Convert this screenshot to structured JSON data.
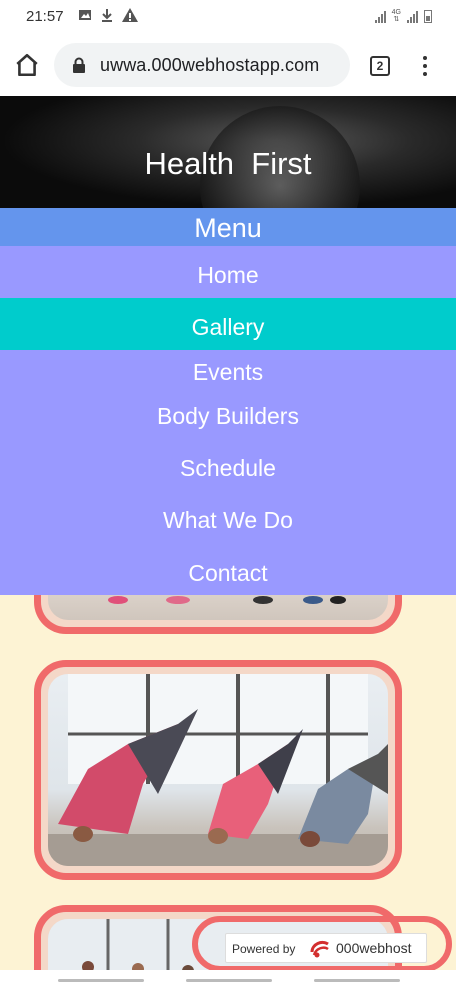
{
  "status_bar": {
    "time": "21:57",
    "left_icons": [
      "image-icon",
      "download-icon",
      "warning-icon"
    ],
    "right_icons": [
      "signal-icon",
      "4g-icon",
      "signal-icon",
      "battery-icon"
    ],
    "network_label": "4G"
  },
  "browser": {
    "url": "uwwa.000webhostapp.com",
    "tab_count": "2"
  },
  "hero": {
    "title": "Health  First"
  },
  "menu": {
    "header": "Menu",
    "items": [
      {
        "label": "Home"
      },
      {
        "label": "Gallery",
        "active": true
      },
      {
        "label": "Events"
      },
      {
        "label": "Body Builders"
      },
      {
        "label": "Schedule"
      },
      {
        "label": "What We Do"
      },
      {
        "label": "Contact"
      }
    ]
  },
  "gallery": {
    "images": [
      "fitness-class-feet-image",
      "yoga-downward-dog-class-image",
      "fitness-class-image"
    ]
  },
  "footer_badge": {
    "label": "Powered by",
    "brand": "000webhost"
  },
  "colors": {
    "menu_header": "#6495ed",
    "menu_bg": "#9999ff",
    "menu_active": "#00cccc",
    "card_border": "#f06a6a",
    "page_bg": "#fdf3d4"
  }
}
